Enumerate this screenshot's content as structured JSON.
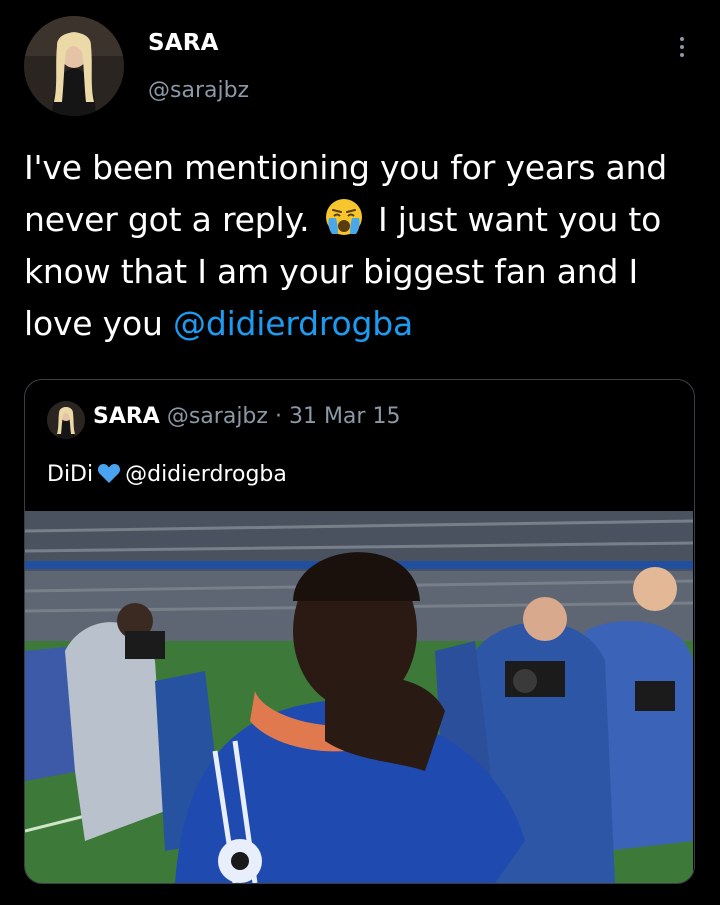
{
  "tweet": {
    "author_name": "SARA",
    "author_handle": "@sarajbz",
    "text_part1": "I've been mentioning you for years and never got a reply.",
    "text_part2": "I just want you to know that I am your biggest fan and I love you",
    "mention": "@didierdrogba",
    "emoji_icon": "loudly-crying-face"
  },
  "quoted": {
    "author_name": "SARA",
    "author_handle": "@sarajbz",
    "separator": "·",
    "date": "31 Mar 15",
    "text": "DiDi",
    "heart_icon": "blue-heart",
    "mention": "@didierdrogba"
  },
  "colors": {
    "background": "#000000",
    "link": "#1d9bf0",
    "secondary_text": "#8b98a5",
    "card_border": "#3a3f44"
  }
}
